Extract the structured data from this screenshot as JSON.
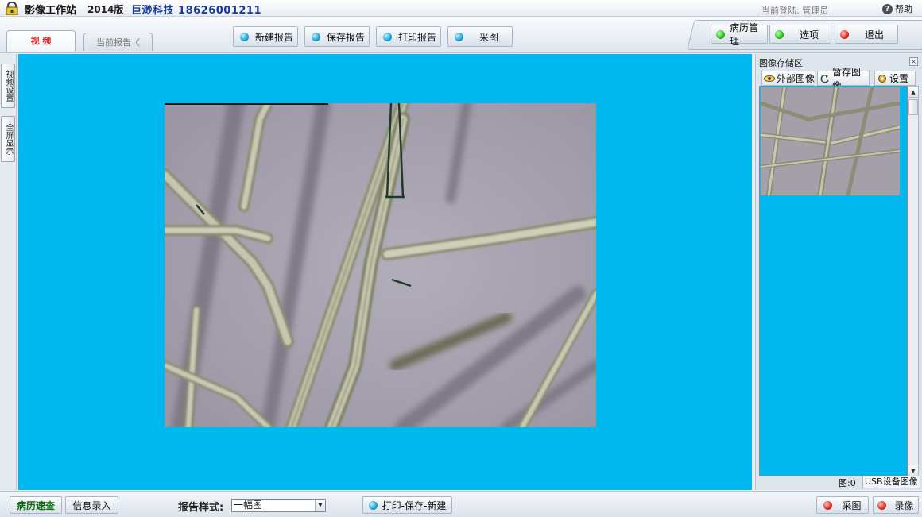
{
  "titlebar": {
    "app_title": "影像工作站",
    "version": "2014版",
    "company": "巨渺科技  18626001211",
    "login": "当前登陆: 管理员",
    "help": "帮助"
  },
  "tabs": {
    "video": "视 频",
    "current_report": "当前报告《"
  },
  "toolbar": {
    "new_report": "新建报告",
    "save_report": "保存报告",
    "print_report": "打印报告",
    "capture": "采图"
  },
  "right_toolbar": {
    "records": "病历管理",
    "options": "选项",
    "exit": "退出"
  },
  "left_tabs": {
    "video_settings": "视频设置",
    "fullscreen": "全屏显示"
  },
  "store": {
    "title": "图像存储区",
    "external": "外部图像",
    "temp": "暂存图像",
    "settings": "设置",
    "count": "图:0",
    "source": "USB设备图像"
  },
  "bottom": {
    "quick_records": "病历速查",
    "info_entry": "信息录入",
    "style_label": "报告样式:",
    "style_value": "一幅图",
    "print_save_new": "打印-保存-新建",
    "capture": "采图",
    "record": "录像"
  },
  "colors": {
    "video_bg": "#00b8f0",
    "accent_red": "#d21a1a",
    "quick_green": "#0a6a12"
  }
}
